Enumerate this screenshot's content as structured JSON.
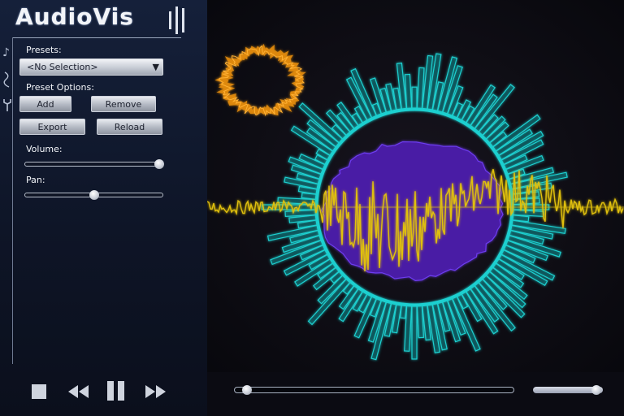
{
  "app": {
    "title": "AudioVis"
  },
  "sidebar": {
    "icons": [
      "music-note-icon",
      "wave-icon",
      "wrench-icon"
    ],
    "presets_label": "Presets:",
    "preset_selected": "<No Selection>",
    "preset_options_label": "Preset Options:",
    "buttons": {
      "add": "Add",
      "remove": "Remove",
      "export": "Export",
      "reload": "Reload"
    },
    "volume_label": "Volume:",
    "volume_value": 1.0,
    "pan_label": "Pan:",
    "pan_value": 0.5
  },
  "transport": {
    "icons": [
      "stop-icon",
      "rewind-icon",
      "pause-icon",
      "fast-forward-icon"
    ],
    "seek_position": 0.03,
    "volume_level": 0.97
  },
  "colors": {
    "accent_cyan": "#1fd0d0",
    "accent_yellow": "#e0c010",
    "accent_purple": "#4a1aa8",
    "accent_orange": "#e08a10",
    "sidebar_bg": "#15203a",
    "viz_bg": "#0b0b12"
  }
}
